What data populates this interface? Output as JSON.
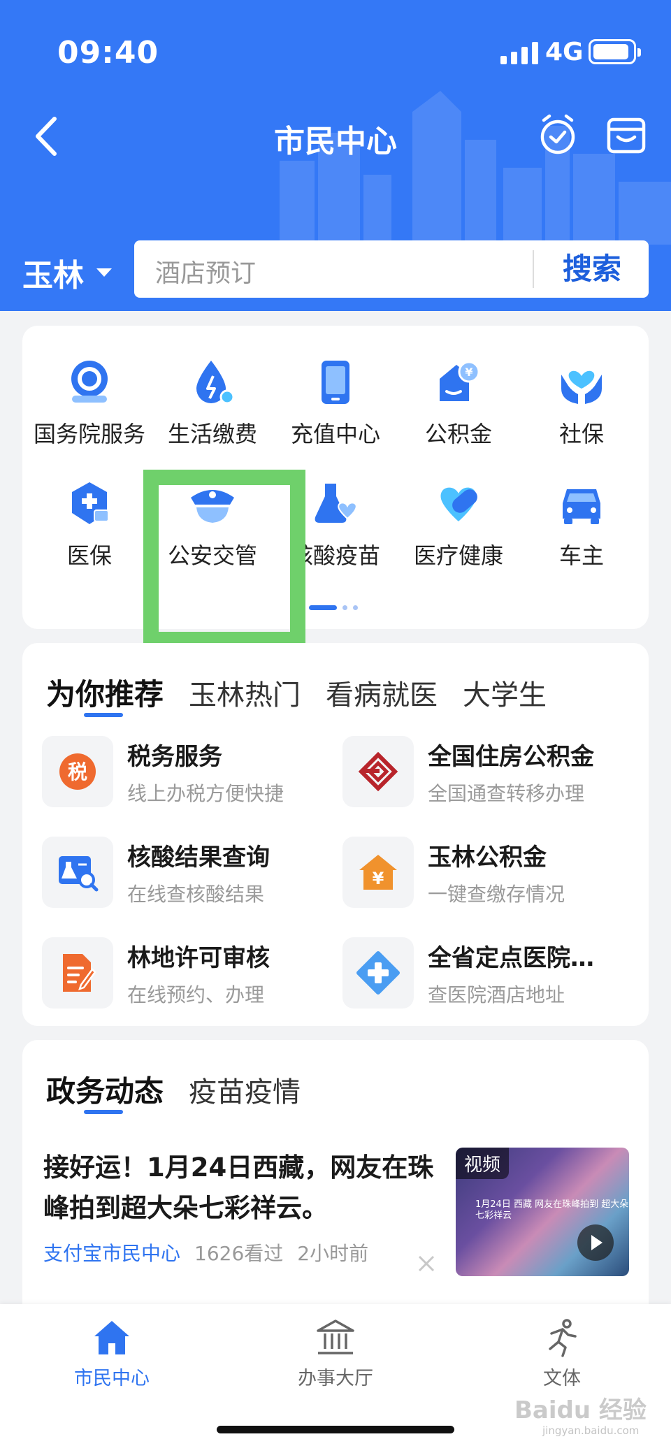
{
  "status_bar": {
    "time": "09:40",
    "network": "4G"
  },
  "header": {
    "title": "市民中心",
    "city": "玉林"
  },
  "search": {
    "placeholder": "酒店预订",
    "button": "搜索"
  },
  "services": [
    {
      "label": "国务院服务",
      "icon": "state-council-icon"
    },
    {
      "label": "生活缴费",
      "icon": "utility-payment-icon"
    },
    {
      "label": "充值中心",
      "icon": "phone-recharge-icon"
    },
    {
      "label": "公积金",
      "icon": "housing-fund-icon"
    },
    {
      "label": "社保",
      "icon": "social-security-icon"
    },
    {
      "label": "医保",
      "icon": "medical-insurance-icon"
    },
    {
      "label": "公安交管",
      "icon": "police-cap-icon"
    },
    {
      "label": "核酸疫苗",
      "icon": "flask-heart-icon"
    },
    {
      "label": "医疗健康",
      "icon": "health-pill-icon"
    },
    {
      "label": "车主",
      "icon": "car-icon"
    }
  ],
  "recommend": {
    "tabs": [
      "为你推荐",
      "玉林热门",
      "看病就医",
      "大学生"
    ],
    "items": [
      {
        "title": "税务服务",
        "subtitle": "线上办税方便快捷",
        "icon": "tax-icon"
      },
      {
        "title": "全国住房公积金",
        "subtitle": "全国通查转移办理",
        "icon": "housing-fund-logo-icon"
      },
      {
        "title": "核酸结果查询",
        "subtitle": "在线查核酸结果",
        "icon": "test-result-search-icon"
      },
      {
        "title": "玉林公积金",
        "subtitle": "一键查缴存情况",
        "icon": "house-yuan-icon"
      },
      {
        "title": "林地许可审核",
        "subtitle": "在线预约、办理",
        "icon": "document-edit-icon"
      },
      {
        "title": "全省定点医院…",
        "subtitle": "查医院酒店地址",
        "icon": "medical-cross-icon"
      }
    ],
    "tax_glyph": "税",
    "yuan_glyph": "¥"
  },
  "news": {
    "tabs": [
      "政务动态",
      "疫苗疫情"
    ],
    "headline": "接好运！1月24日西藏，网友在珠峰拍到超大朵七彩祥云。",
    "source": "支付宝市民中心",
    "views": "1626看过",
    "time": "2小时前",
    "video_tag": "视频",
    "video_caption": "1月24日 西藏 网友在珠峰拍到 超大朵七彩祥云"
  },
  "bottom_nav": [
    {
      "label": "市民中心",
      "active": true
    },
    {
      "label": "办事大厅",
      "active": false
    },
    {
      "label": "文体",
      "active": false
    }
  ],
  "watermark": {
    "brand": "Baidu 经验",
    "url": "jingyan.baidu.com"
  },
  "colors": {
    "primary": "#3478f6",
    "accent": "#2f74f0",
    "highlight": "#6fd06b"
  }
}
